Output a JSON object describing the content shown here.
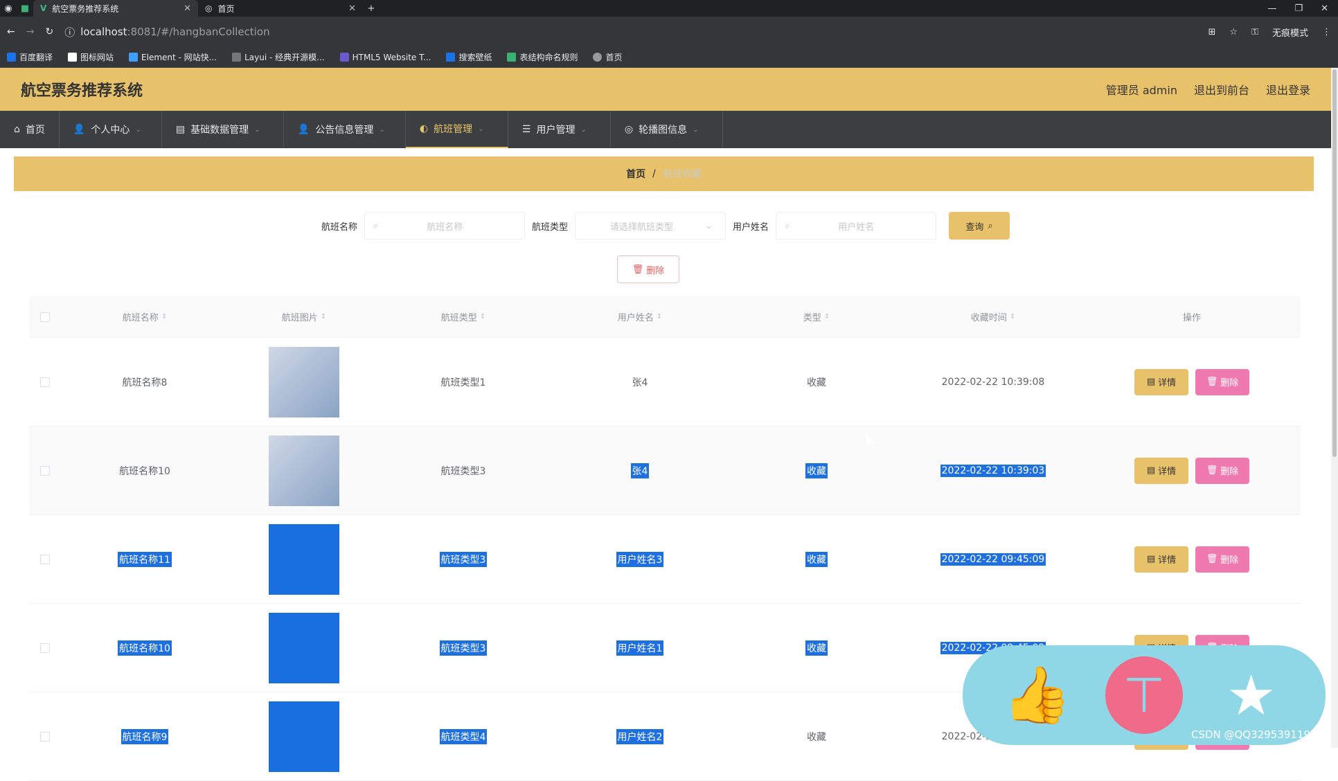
{
  "browser": {
    "tabs": [
      {
        "title": "航空票务推荐系统",
        "active": true
      },
      {
        "title": "首页",
        "active": false
      }
    ],
    "url_host": "localhost",
    "url_rest": ":8081/#/hangbanCollection",
    "incognito_label": "无痕模式",
    "bookmarks": [
      "百度翻译",
      "图标网站",
      "Element - 网站快...",
      "Layui - 经典开源模...",
      "HTML5 Website T...",
      "搜索壁纸",
      "表结构命名规则",
      "首页"
    ]
  },
  "app": {
    "title": "航空票务推荐系统",
    "header_links": [
      "管理员 admin",
      "退出到前台",
      "退出登录"
    ]
  },
  "nav": {
    "items": [
      "首页",
      "个人中心",
      "基础数据管理",
      "公告信息管理",
      "航班管理",
      "用户管理",
      "轮播图信息"
    ],
    "active_index": 4
  },
  "breadcrumb": {
    "home": "首页",
    "sep": "/",
    "current": "航班收藏"
  },
  "search": {
    "name_label": "航班名称",
    "name_placeholder": "航班名称",
    "type_label": "航班类型",
    "type_placeholder": "请选择航班类型",
    "user_label": "用户姓名",
    "user_placeholder": "用户姓名",
    "query_label": "查询"
  },
  "toolbar": {
    "delete_label": "删除"
  },
  "table": {
    "headers": [
      "航班名称",
      "航班图片",
      "航班类型",
      "用户姓名",
      "类型",
      "收藏时间",
      "操作"
    ],
    "rows": [
      {
        "name": "航班名称8",
        "type": "航班类型1",
        "user": "张4",
        "kind": "收藏",
        "time": "2022-02-22 10:39:08"
      },
      {
        "name": "航班名称10",
        "type": "航班类型3",
        "user": "张4",
        "kind": "收藏",
        "time": "2022-02-22 10:39:03"
      },
      {
        "name": "航班名称11",
        "type": "航班类型3",
        "user": "用户姓名3",
        "kind": "收藏",
        "time": "2022-02-22 09:45:09"
      },
      {
        "name": "航班名称10",
        "type": "航班类型3",
        "user": "用户姓名1",
        "kind": "收藏",
        "time": "2022-02-22 09:45:09"
      },
      {
        "name": "航班名称9",
        "type": "航班类型4",
        "user": "用户姓名2",
        "kind": "收藏",
        "time": "2022-02-22 09:45:09"
      }
    ],
    "detail_label": "详情",
    "delete_label": "删除"
  },
  "watermark": "CSDN @QQ3295391197",
  "colors": {
    "accent": "#e8c26a",
    "nav_bg": "#3c3f41",
    "danger": "#f07ab0",
    "selection": "#1e6fe0"
  }
}
